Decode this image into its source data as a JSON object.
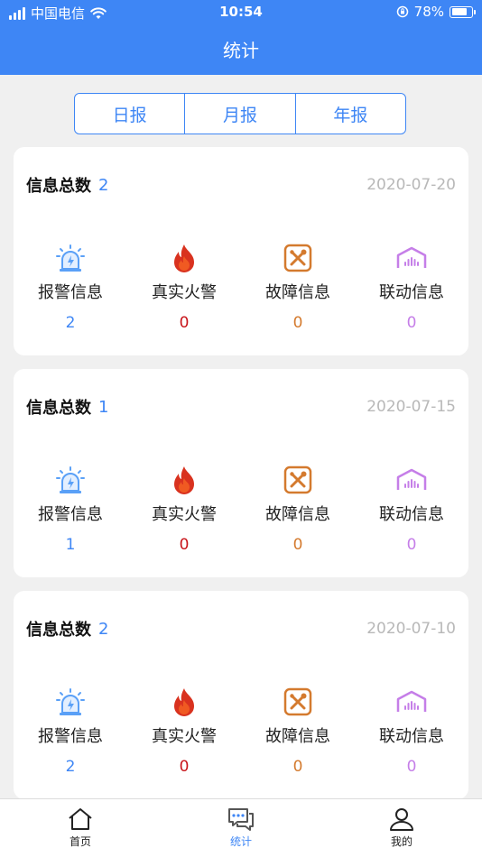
{
  "status_bar": {
    "carrier": "中国电信",
    "time": "10:54",
    "battery": "78%",
    "battery_level": 0.78
  },
  "header": {
    "title": "统计"
  },
  "tabs": [
    {
      "label": "日报",
      "active": true
    },
    {
      "label": "月报",
      "active": false
    },
    {
      "label": "年报",
      "active": false
    }
  ],
  "colors": {
    "primary": "#3e86f5",
    "alarm": "#3e86f5",
    "fire": "#c8141a",
    "fault": "#d47a2e",
    "linkage": "#c57ee8"
  },
  "stat_labels": {
    "alarm": "报警信息",
    "fire": "真实火警",
    "fault": "故障信息",
    "linkage": "联动信息"
  },
  "cards": [
    {
      "label": "信息总数",
      "total": "2",
      "date": "2020-07-20",
      "stats": {
        "alarm": "2",
        "fire": "0",
        "fault": "0",
        "linkage": "0"
      }
    },
    {
      "label": "信息总数",
      "total": "1",
      "date": "2020-07-15",
      "stats": {
        "alarm": "1",
        "fire": "0",
        "fault": "0",
        "linkage": "0"
      }
    },
    {
      "label": "信息总数",
      "total": "2",
      "date": "2020-07-10",
      "stats": {
        "alarm": "2",
        "fire": "0",
        "fault": "0",
        "linkage": "0"
      }
    }
  ],
  "nav": [
    {
      "label": "首页",
      "icon": "home-icon",
      "active": false
    },
    {
      "label": "统计",
      "icon": "chat-stats-icon",
      "active": true
    },
    {
      "label": "我的",
      "icon": "user-icon",
      "active": false
    }
  ]
}
